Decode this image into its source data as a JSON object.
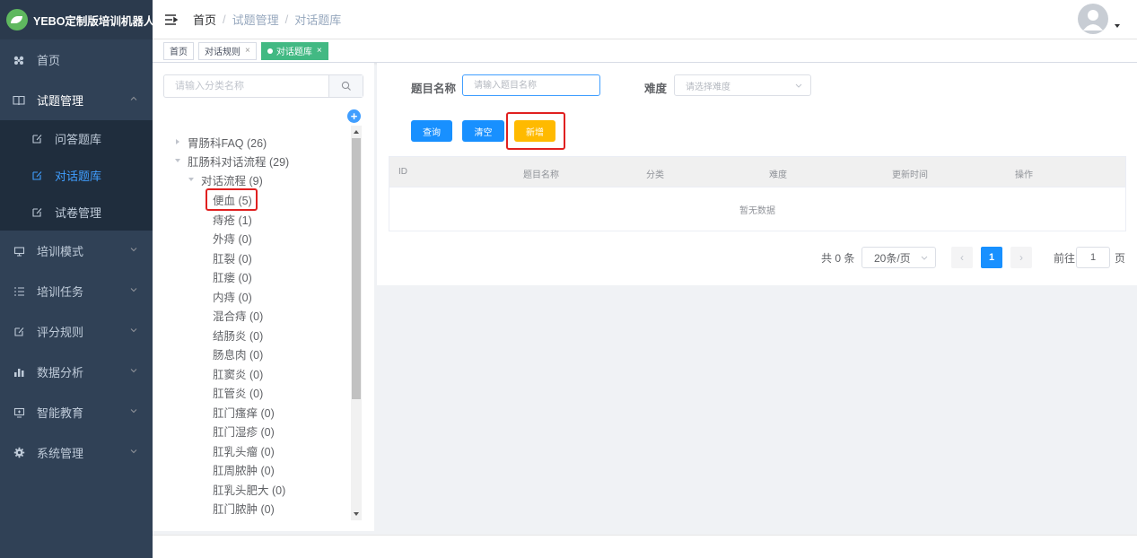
{
  "app": {
    "title": "YEBO定制版培训机器人"
  },
  "sidebar": {
    "items": [
      {
        "label": "首页",
        "icon": "dashboard-icon"
      },
      {
        "label": "试题管理",
        "icon": "book-icon",
        "open": true,
        "children": [
          {
            "label": "问答题库",
            "icon": "edit-icon"
          },
          {
            "label": "对话题库",
            "icon": "edit-icon",
            "active": true
          },
          {
            "label": "试卷管理",
            "icon": "edit-icon"
          }
        ]
      },
      {
        "label": "培训模式",
        "icon": "monitor-icon"
      },
      {
        "label": "培训任务",
        "icon": "list-icon"
      },
      {
        "label": "评分规则",
        "icon": "edit-icon"
      },
      {
        "label": "数据分析",
        "icon": "bar-chart-icon"
      },
      {
        "label": "智能教育",
        "icon": "education-icon"
      },
      {
        "label": "系统管理",
        "icon": "gear-icon"
      }
    ]
  },
  "header": {
    "breadcrumb": [
      "首页",
      "试题管理",
      "对话题库"
    ]
  },
  "tags": [
    {
      "label": "首页",
      "closable": false
    },
    {
      "label": "对话规则",
      "closable": true
    },
    {
      "label": "对话题库",
      "closable": true,
      "active": true
    }
  ],
  "tags_close_symbol": "×",
  "tree": {
    "search_placeholder": "请输入分类名称",
    "add_symbol": "+",
    "nodes": [
      {
        "label": "胃肠科FAQ (26)",
        "level": 0,
        "expanded": false
      },
      {
        "label": "肛肠科对话流程 (29)",
        "level": 0,
        "expanded": true
      },
      {
        "label": "对话流程 (9)",
        "level": 1,
        "expanded": true
      },
      {
        "label": "便血 (5)",
        "level": 2,
        "highlighted": true
      },
      {
        "label": "痔疮 (1)",
        "level": 2
      },
      {
        "label": "外痔 (0)",
        "level": 2
      },
      {
        "label": "肛裂 (0)",
        "level": 2
      },
      {
        "label": "肛瘘 (0)",
        "level": 2
      },
      {
        "label": "内痔 (0)",
        "level": 2
      },
      {
        "label": "混合痔 (0)",
        "level": 2
      },
      {
        "label": "结肠炎 (0)",
        "level": 2
      },
      {
        "label": "肠息肉 (0)",
        "level": 2
      },
      {
        "label": "肛窦炎 (0)",
        "level": 2
      },
      {
        "label": "肛管炎 (0)",
        "level": 2
      },
      {
        "label": "肛门瘙痒 (0)",
        "level": 2
      },
      {
        "label": "肛门湿疹 (0)",
        "level": 2
      },
      {
        "label": "肛乳头瘤 (0)",
        "level": 2
      },
      {
        "label": "肛周脓肿 (0)",
        "level": 2
      },
      {
        "label": "肛乳头肥大 (0)",
        "level": 2
      },
      {
        "label": "肛门脓肿 (0)",
        "level": 2
      }
    ]
  },
  "filters": {
    "name_label": "题目名称",
    "name_placeholder": "请输入题目名称",
    "difficulty_label": "难度",
    "difficulty_placeholder": "请选择难度"
  },
  "buttons": {
    "query": "查询",
    "clear": "清空",
    "add": "新增"
  },
  "table": {
    "columns": [
      "ID",
      "题目名称",
      "分类",
      "难度",
      "更新时间",
      "操作"
    ],
    "empty_text": "暂无数据"
  },
  "pagination": {
    "total": "共 0 条",
    "page_size": "20条/页",
    "prev": "‹",
    "current": "1",
    "next": "›",
    "goto_prefix": "前往",
    "goto_value": "1",
    "goto_suffix": "页"
  },
  "colors": {
    "sidebar_bg": "#304156",
    "submenu_bg": "#1f2d3d",
    "active_menu": "#409eff",
    "active_tag": "#42b983",
    "primary": "#1890ff",
    "warning": "#ffba00",
    "highlight": "#e02020"
  }
}
